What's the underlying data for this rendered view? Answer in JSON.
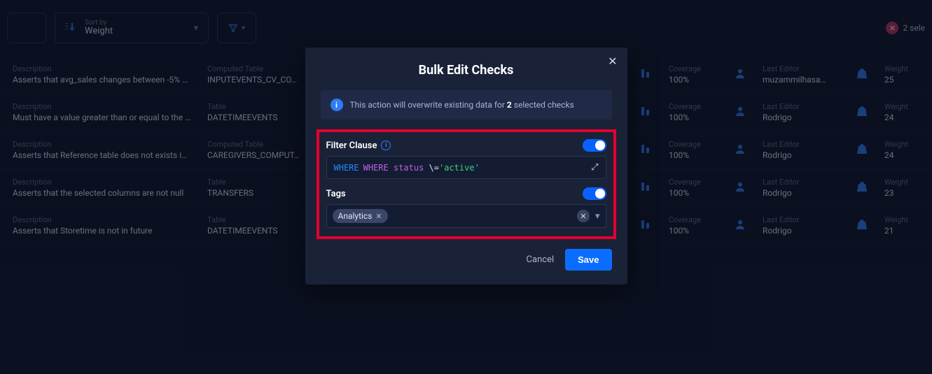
{
  "toolbar": {
    "sort_label": "Sort by",
    "sort_value": "Weight",
    "selected_text": "2 sele"
  },
  "headers": {
    "description": "Description",
    "computed_table": "Computed Table",
    "table": "Table",
    "coverage": "Coverage",
    "last_editor": "Last Editor",
    "weight": "Weight"
  },
  "rows": [
    {
      "desc": "Asserts that avg_sales changes between -5% …",
      "table_label": "Computed Table",
      "table": "INPUTEVENTS_CV_CO…",
      "coverage": "100%",
      "editor": "muzammilhasa…",
      "weight": "25"
    },
    {
      "desc": "Must have a value greater than or equal to the …",
      "table_label": "Table",
      "table": "DATETIMEEVENTS",
      "coverage": "100%",
      "editor": "Rodrigo",
      "weight": "24"
    },
    {
      "desc": "Asserts that Reference table does not exists i…",
      "table_label": "Computed Table",
      "table": "CAREGIVERS_COMPUT…",
      "coverage": "100%",
      "editor": "Rodrigo",
      "weight": "24"
    },
    {
      "desc": "Asserts that the selected columns are not null",
      "table_label": "Table",
      "table": "TRANSFERS",
      "coverage": "100%",
      "editor": "Rodrigo",
      "weight": "23"
    },
    {
      "desc": "Asserts that Storetime is not in future",
      "table_label": "Table",
      "table": "DATETIMEEVENTS",
      "coverage": "100%",
      "editor": "Rodrigo",
      "weight": "21"
    }
  ],
  "modal": {
    "title": "Bulk Edit Checks",
    "info_pre": "This action will overwrite existing data for ",
    "info_count": "2",
    "info_post": " selected checks",
    "filter_label": "Filter Clause",
    "filter_kw1": "WHERE",
    "filter_kw2": "WHERE status ",
    "filter_op": "\\=",
    "filter_str": "'active'",
    "tags_label": "Tags",
    "tag_chip": "Analytics",
    "cancel": "Cancel",
    "save": "Save"
  }
}
